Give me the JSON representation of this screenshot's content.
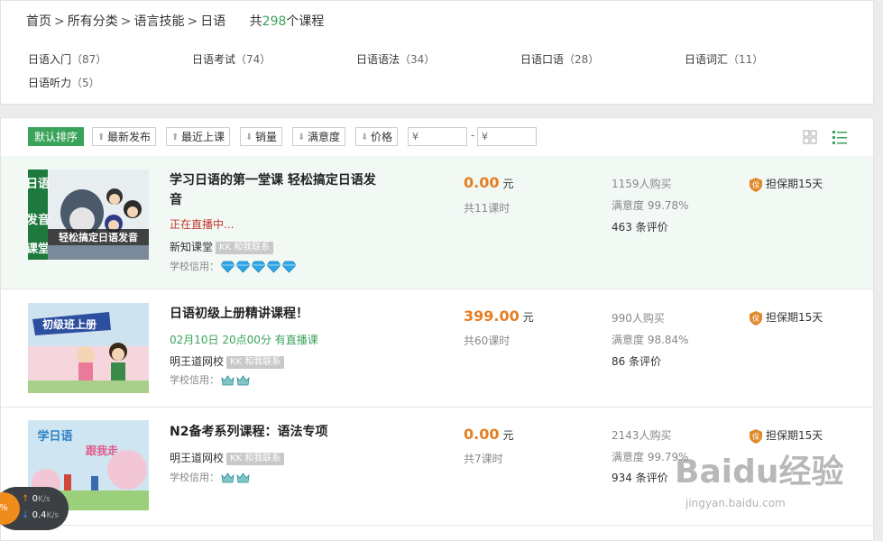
{
  "breadcrumb": {
    "items": [
      "首页",
      "所有分类",
      "语言技能",
      "日语"
    ],
    "separator": ">",
    "count_prefix": "共",
    "count": "298",
    "count_suffix": "个课程"
  },
  "categories": [
    {
      "label": "日语入门",
      "count": "（87）"
    },
    {
      "label": "日语考试",
      "count": "（74）"
    },
    {
      "label": "日语语法",
      "count": "（34）"
    },
    {
      "label": "日语口语",
      "count": "（28）"
    },
    {
      "label": "日语词汇",
      "count": "（11）"
    },
    {
      "label": "日语听力",
      "count": "（5）"
    }
  ],
  "toolbar": {
    "sorts": [
      "默认排序",
      "最新发布",
      "最近上课",
      "销量",
      "满意度",
      "价格"
    ],
    "price_min_placeholder": "¥",
    "price_max_placeholder": "¥",
    "dash": "-"
  },
  "courses": [
    {
      "title": "学习日语的第一堂课 轻松搞定日语发音",
      "status": "正在直播中...",
      "school": "新知课堂",
      "contact": "KK 和我联系",
      "credit_label": "学校信用：",
      "credit_level": 5,
      "credit_icon": "diamond-icon",
      "price": "0.00",
      "unit": "元",
      "hours": "共11课时",
      "buyers": "1159人购买",
      "satisfaction": "满意度 99.78%",
      "reviews": "463 条评价",
      "guarantee": "担保期15天",
      "thumb_text": [
        "日语",
        "发音",
        "课堂"
      ],
      "thumb_banner": "轻松搞定日语发音"
    },
    {
      "title": "日语初级上册精讲课程！",
      "status": "",
      "schedule": "02月10日 20点00分 有直播课",
      "school": "明王道网校",
      "contact": "KK 和我联系",
      "credit_label": "学校信用：",
      "credit_level": 2,
      "credit_icon": "crown-icon",
      "price": "399.00",
      "unit": "元",
      "hours": "共60课时",
      "buyers": "990人购买",
      "satisfaction": "满意度 98.84%",
      "reviews": "86 条评价",
      "guarantee": "担保期15天",
      "thumb_text": [
        "初级班上册"
      ]
    },
    {
      "title": "N2备考系列课程：语法专项",
      "status": "",
      "school": "明王道网校",
      "contact": "KK 和我联系",
      "credit_label": "学校信用：",
      "credit_level": 2,
      "credit_icon": "crown-icon",
      "price": "0.00",
      "unit": "元",
      "hours": "共7课时",
      "buyers": "2143人购买",
      "satisfaction": "满意度 99.79%",
      "reviews": "934 条评价",
      "guarantee": "担保期15天",
      "thumb_text": [
        "学日语",
        "跟我走"
      ]
    }
  ],
  "speed": {
    "percent": "%",
    "up": "0",
    "down": "0.4",
    "unit": "K/s"
  },
  "watermark": {
    "brand": "Baidu经验",
    "url": "jingyan.baidu.com"
  },
  "colors": {
    "accent": "#3aa35a",
    "price": "#e67e22",
    "live": "#c0392b"
  }
}
